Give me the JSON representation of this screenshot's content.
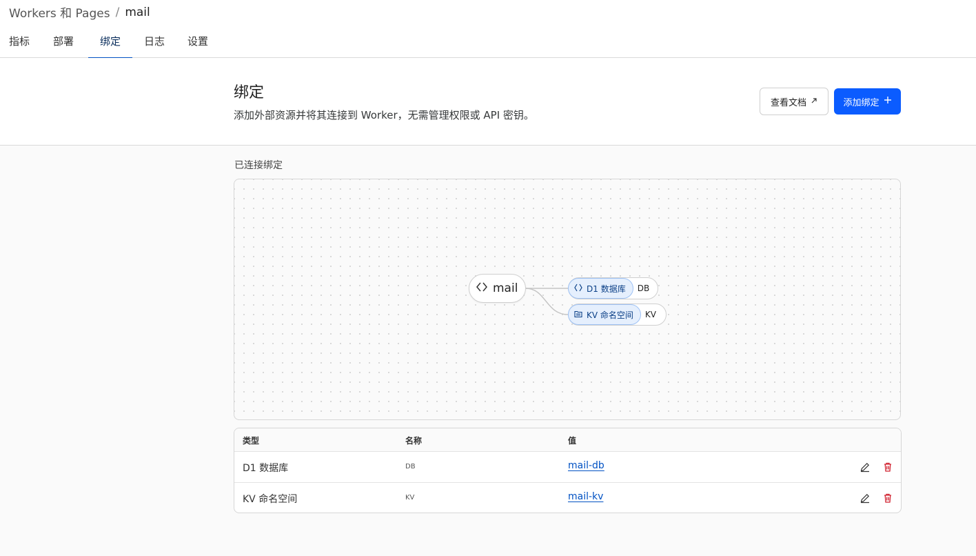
{
  "breadcrumb": {
    "parent": "Workers 和 Pages",
    "separator": "/",
    "current": "mail"
  },
  "tabs": [
    {
      "label": "指标"
    },
    {
      "label": "部署"
    },
    {
      "label": "绑定",
      "active": true
    },
    {
      "label": "日志"
    },
    {
      "label": "设置"
    }
  ],
  "header": {
    "title": "绑定",
    "description": "添加外部资源并将其连接到 Worker，无需管理权限或 API 密钥。",
    "docs_button": "查看文档",
    "add_button": "添加绑定",
    "accent_color": "#0b5cff"
  },
  "connected": {
    "label": "已连接绑定",
    "worker_name": "mail",
    "bindings": [
      {
        "type_label": "D1 数据库",
        "name": "DB",
        "icon": "d1-database-icon"
      },
      {
        "type_label": "KV 命名空间",
        "name": "KV",
        "icon": "kv-namespace-icon"
      }
    ]
  },
  "table": {
    "headers": {
      "type": "类型",
      "name": "名称",
      "value": "值"
    },
    "rows": [
      {
        "type": "D1 数据库",
        "name": "DB",
        "value": "mail-db"
      },
      {
        "type": "KV 命名空间",
        "name": "KV",
        "value": "mail-kv"
      }
    ],
    "delete_color": "#d0202e"
  }
}
